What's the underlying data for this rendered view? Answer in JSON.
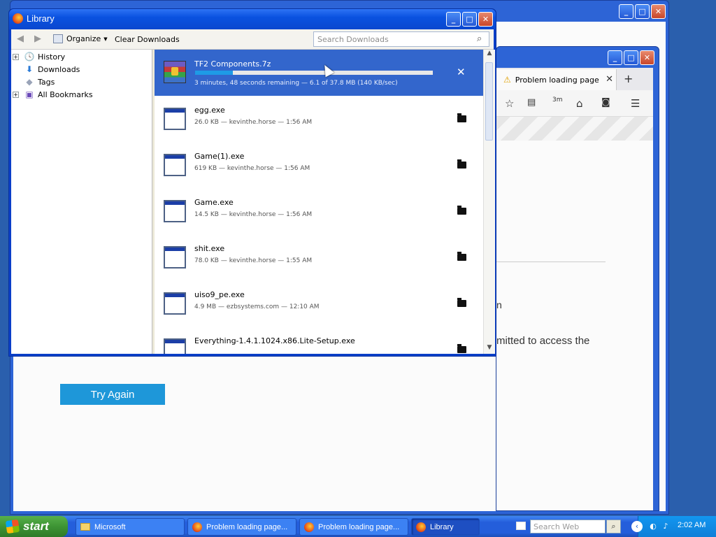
{
  "background_window": {
    "try_again_label": "Try Again"
  },
  "middle_window": {
    "tab_title": "Problem loading page",
    "new_tab": "+",
    "partial_text_1": "n",
    "partial_text_2": "mitted to access the",
    "toolbar_badge": "3m"
  },
  "library": {
    "title": "Library",
    "toolbar": {
      "organize_label": "Organize",
      "clear_downloads_label": "Clear Downloads",
      "search_placeholder": "Search Downloads"
    },
    "sidebar": [
      {
        "label": "History",
        "icon": "clock-icon",
        "expandable": true
      },
      {
        "label": "Downloads",
        "icon": "download-arrow-icon",
        "expandable": false
      },
      {
        "label": "Tags",
        "icon": "tag-icon",
        "expandable": false
      },
      {
        "label": "All Bookmarks",
        "icon": "bookmarks-icon",
        "expandable": true
      }
    ],
    "downloads": [
      {
        "name": "TF2 Components.7z",
        "meta": "3 minutes, 48 seconds remaining — 6.1 of 37.8 MB (140 KB/sec)",
        "progress": 0.16,
        "active": true
      },
      {
        "name": "egg.exe",
        "meta": "26.0 KB — kevinthe.horse — 1:56 AM"
      },
      {
        "name": "Game(1).exe",
        "meta": "619 KB — kevinthe.horse — 1:56 AM"
      },
      {
        "name": "Game.exe",
        "meta": "14.5 KB — kevinthe.horse — 1:56 AM"
      },
      {
        "name": "shit.exe",
        "meta": "78.0 KB — kevinthe.horse — 1:55 AM"
      },
      {
        "name": "uiso9_pe.exe",
        "meta": "4.9 MB — ezbsystems.com — 12:10 AM"
      },
      {
        "name": "Everything-1.4.1.1024.x86.Lite-Setup.exe",
        "meta": ""
      }
    ]
  },
  "taskbar": {
    "start_label": "start",
    "tasks": [
      {
        "label": "Microsoft",
        "icon": "folder-icon"
      },
      {
        "label": "Problem loading page...",
        "icon": "firefox-icon"
      },
      {
        "label": "Problem loading page...",
        "icon": "firefox-icon"
      },
      {
        "label": "Library",
        "icon": "firefox-icon",
        "active": true
      }
    ],
    "search_placeholder": "Search Web",
    "clock": "2:02 AM"
  }
}
